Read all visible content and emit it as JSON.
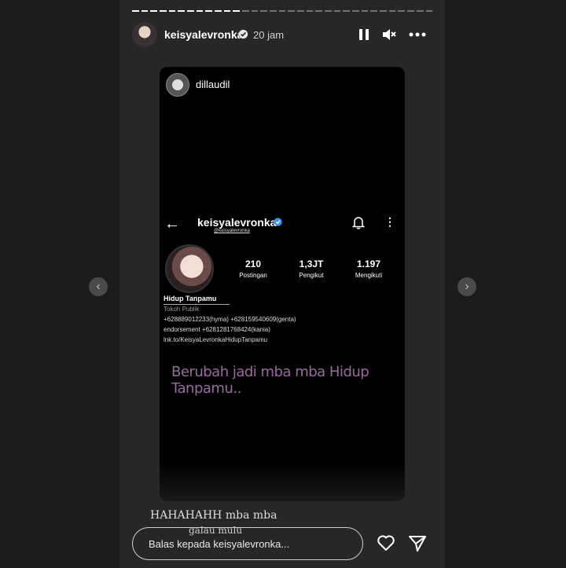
{
  "story": {
    "username": "keisyalevronka",
    "time_ago": "20 jam",
    "segments_total": 33,
    "segments_done": 12,
    "handwritten_line1": "HAHAHAHH mba mba",
    "handwritten_line2": "galau mulu"
  },
  "reposted": {
    "username": "dillaudil",
    "profile": {
      "name": "keisyalevronka",
      "handle": "@keisyalevronka",
      "stats": [
        {
          "value": "210",
          "label": "Postingan"
        },
        {
          "value": "1,3JT",
          "label": "Pengikut"
        },
        {
          "value": "1.197",
          "label": "Mengikuti"
        }
      ],
      "bio_name": "Hidup Tanpamu",
      "category": "Tokoh Publik",
      "bio_lines": [
        "+628889012233(hyma) +628159540609(genta)",
        "endorsement +6281281768424(kania)",
        "lnk.to/KeisyaLevronkaHidupTanpamu"
      ]
    },
    "caption": "Berubah jadi mba mba Hidup Tanpamu.."
  },
  "reply": {
    "placeholder": "Balas kepada keisyalevronka..."
  },
  "icons": {
    "pause": "pause-icon",
    "mute": "mute-icon",
    "more": "more-icon",
    "heart": "heart-icon",
    "send": "send-icon",
    "prev": "chevron-left-icon",
    "next": "chevron-right-icon"
  },
  "colors": {
    "verified": "#3897f0",
    "caption": "#9a6a9e"
  }
}
